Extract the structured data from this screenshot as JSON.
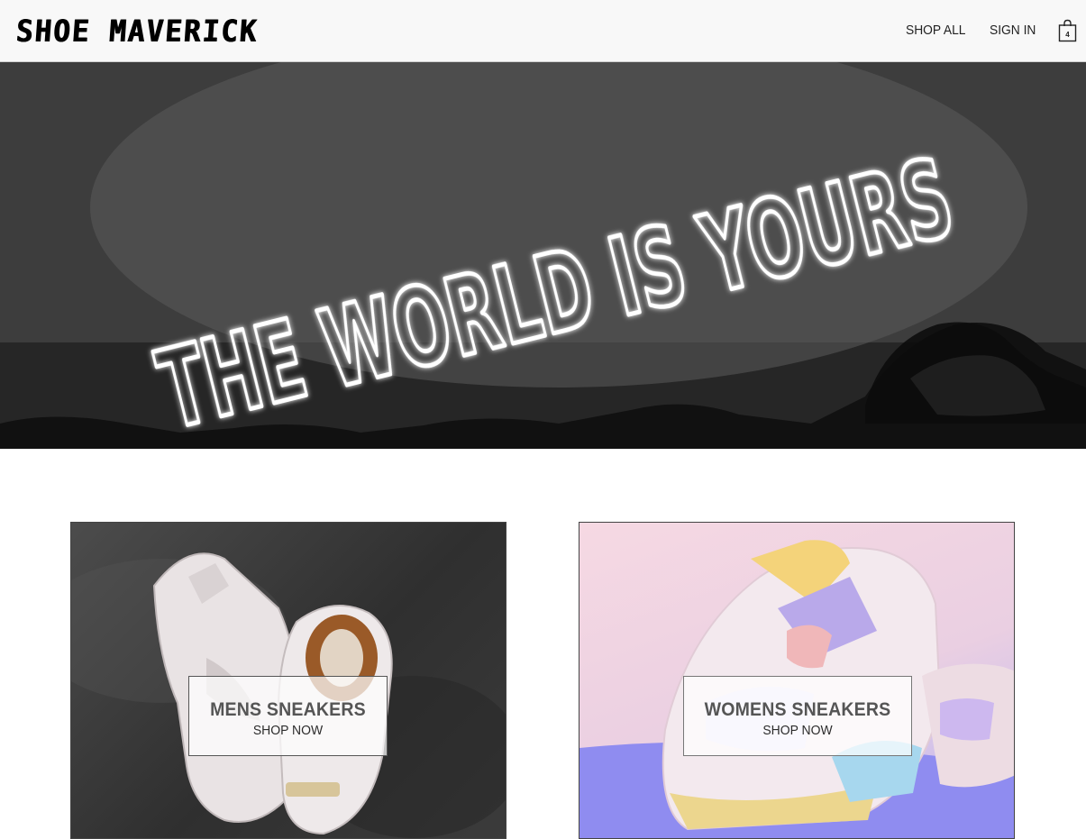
{
  "header": {
    "logo": "SHOE MAVERICK",
    "nav": {
      "shop_all": "SHOP ALL",
      "sign_in": "SIGN IN"
    },
    "cart": {
      "count": "4",
      "icon": "shopping-bag-icon"
    }
  },
  "hero": {
    "neon_text": "THE WORLD IS YOURS",
    "background": "grayscale photo of neon sign above sneakers"
  },
  "categories": [
    {
      "title": "MENS SNEAKERS",
      "cta": "SHOP NOW"
    },
    {
      "title": "WOMENS SNEAKERS",
      "cta": "SHOP NOW"
    }
  ],
  "colors": {
    "header_bg": "#f8f8f8",
    "text": "#222222",
    "overlay_bg": "#ffffffb8"
  }
}
